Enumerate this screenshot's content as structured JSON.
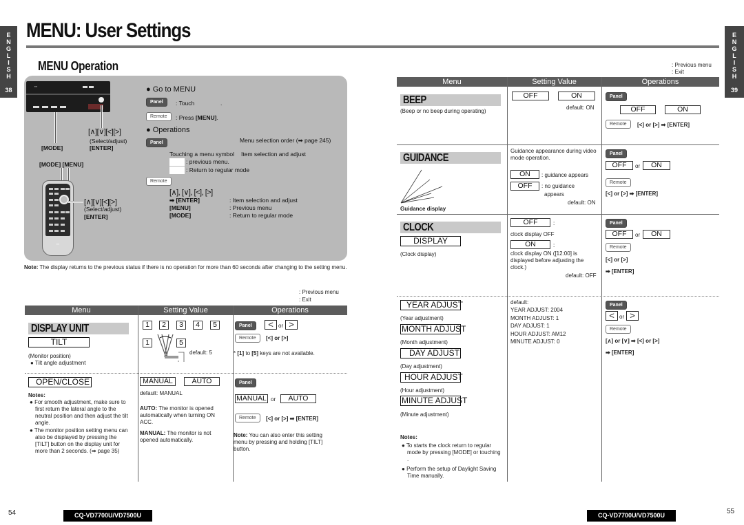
{
  "side_tabs": {
    "left": {
      "letters": [
        "E",
        "N",
        "G",
        "L",
        "I",
        "S",
        "H"
      ],
      "page": "38"
    },
    "right": {
      "letters": [
        "E",
        "N",
        "G",
        "L",
        "I",
        "S",
        "H"
      ],
      "page": "39"
    }
  },
  "title": "MENU: User Settings",
  "subtitle": "MENU Operation",
  "operation_panel": {
    "mode_label": "[MODE]",
    "head_arrows": "[∧][∨][<][>]",
    "head_select": "(Select/adjust)",
    "head_enter": "[ENTER]",
    "remote_labels": "[MODE]  [MENU]",
    "remote_arrows": "[∧][∨][<][>]",
    "remote_select": "(Select/adjust)",
    "remote_enter": "[ENTER]",
    "go_to_menu": "● Go to MENU",
    "panel_label": "Panel",
    "remote_label": "Remote",
    "touch": ": Touch",
    "touch_dot": ".",
    "press_prefix": ": Press ",
    "press_key": "[MENU]",
    "press_suffix": ".",
    "operations": "● Operations",
    "selection_order": "Menu selection order (➡ page 245)",
    "touching_symbol": "Touching a menu symbol",
    "item_selection": "Item selection and adjust",
    "previous_menu": ": previous menu.",
    "return_regular": ": Return to regular mode",
    "remote_keys": "[∧], [∨], [<], [>]",
    "remote_rows": [
      {
        "key": "➡ [ENTER]",
        "desc": ": Item selection and adjust"
      },
      {
        "key": "[MENU]",
        "desc": ": Previous menu"
      },
      {
        "key": "[MODE]",
        "desc": ": Return to regular mode"
      }
    ]
  },
  "note": {
    "label": "Note:",
    "text": " The display returns to the previous status if there is no operation for more than 60 seconds after changing to the setting menu."
  },
  "legend": {
    "previous": ": Previous menu",
    "exit": ": Exit"
  },
  "table_headers": {
    "menu": "Menu",
    "setting": "Setting Value",
    "operations": "Operations"
  },
  "left_table": {
    "display_unit": {
      "title": "DISPLAY UNIT",
      "tilt": {
        "label": "TILT",
        "desc": "(Monitor position)",
        "bullet": "● Tilt angle adjustment",
        "values": [
          "1",
          "2",
          "3",
          "4",
          "5"
        ],
        "range_low": "1",
        "range_high": "5",
        "default": "default: 5",
        "op_or": "or",
        "remote_keys": "[<] or [>]",
        "note_pre": "* ",
        "note_k1": "[1]",
        "note_mid": " to ",
        "note_k2": "[5]",
        "note_post": " keys are not available."
      },
      "open_close": {
        "label": "OPEN/CLOSE",
        "notes_title": "Notes:",
        "notes": [
          "For smooth adjustment, make sure to first return the lateral angle to the neutral position and then adjust the tilt angle.",
          "The monitor position setting menu can also be displayed by pressing the [TILT] button on the display unit for more than 2 seconds. (➡ page 35)"
        ],
        "values": [
          "MANUAL",
          "AUTO"
        ],
        "default": "default: MANUAL",
        "auto_label": "AUTO:",
        "auto_text": " The monitor is opened automatically when turning ON ACC.",
        "manual_label": "MANUAL:",
        "manual_text": " The monitor is not opened automatically.",
        "op_or": "or",
        "remote_seq": "[<] or [>] ➡ [ENTER]",
        "note_label": "Note:",
        "note_text": " You can also enter this setting menu by pressing and holding [TILT] button."
      }
    }
  },
  "right_table": {
    "beep": {
      "title": "BEEP",
      "desc": "(Beep or no beep during operating)",
      "values": [
        "OFF",
        "ON"
      ],
      "default": "default: ON",
      "remote_seq": "[<] or [>] ➡ [ENTER]"
    },
    "guidance": {
      "title": "GUIDANCE",
      "caption": "Guidance display",
      "intro": "Guidance appearance during video mode operation.",
      "on": "ON",
      "on_desc": ": guidance appears",
      "off": "OFF",
      "off_desc": ": no guidance",
      "off_desc2": "appears",
      "default": "default: ON",
      "op_or": "or",
      "remote_seq": "[<] or [>] ➡ [ENTER]"
    },
    "clock": {
      "title": "CLOCK",
      "display_label": "DISPLAY",
      "desc": "(Clock display)",
      "off": "OFF",
      "off_desc": "clock display OFF",
      "on": "ON",
      "on_desc": "clock display ON ([12:00] is displayed before adjusting the clock.)",
      "default": "default: OFF",
      "op_or": "or",
      "remote_seq1": "[<] or [>]",
      "remote_seq2": "➡ [ENTER]",
      "colon": ":"
    },
    "clock_adjust": {
      "items": [
        {
          "label": "YEAR ADJUST",
          "desc": "(Year adjustment)"
        },
        {
          "label": "MONTH ADJUST",
          "desc": "(Month adjustment)"
        },
        {
          "label": "DAY ADJUST",
          "desc": "(Day adjustment)"
        },
        {
          "label": "HOUR ADJUST",
          "desc": "(Hour adjustment)"
        },
        {
          "label": "MINUTE ADJUST",
          "desc": "(Minute adjustment)"
        }
      ],
      "defaults": [
        "default:",
        "YEAR ADJUST: 2004",
        "MONTH ADJUST: 1",
        "DAY ADJUST: 1",
        "HOUR ADJUST: AM12",
        "MINUTE ADJUST: 0"
      ],
      "op_or": "or",
      "remote_seq1": "[∧] or [∨] ➡ [<] or [>]",
      "remote_seq2": "➡ [ENTER]",
      "notes_title": "Notes:",
      "notes": [
        "To starts the clock return to regular mode by pressing [MODE] or touching        .",
        "Perform the setup of Daylight Saving Time manually."
      ]
    }
  },
  "footer": {
    "left_page": "54",
    "right_page": "55",
    "model": "CQ-VD7700U/VD7500U"
  }
}
